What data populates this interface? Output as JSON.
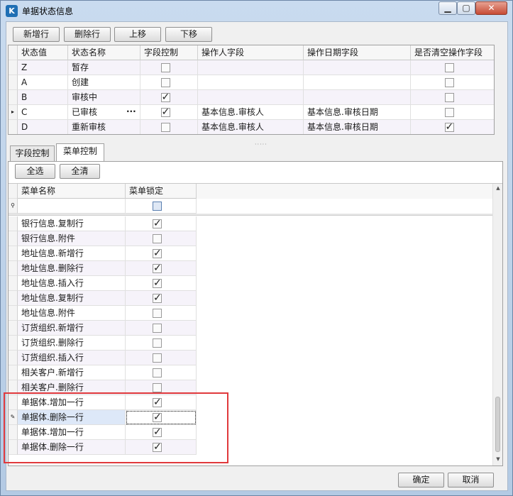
{
  "window": {
    "title": "单据状态信息",
    "app_icon": "K",
    "minimize": "▁",
    "maximize": "▢",
    "close": "✕"
  },
  "toolbar": {
    "add_row": "新增行",
    "delete_row": "删除行",
    "move_up": "上移",
    "move_down": "下移"
  },
  "status_grid": {
    "columns": [
      "状态值",
      "状态名称",
      "字段控制",
      "操作人字段",
      "操作日期字段",
      "是否清空操作字段"
    ],
    "rows": [
      {
        "value": "Z",
        "name": "暂存",
        "field_control": false,
        "operator_field": "",
        "date_field": "",
        "clear_fields": false,
        "current": false
      },
      {
        "value": "A",
        "name": "创建",
        "field_control": false,
        "operator_field": "",
        "date_field": "",
        "clear_fields": false,
        "current": false
      },
      {
        "value": "B",
        "name": "审核中",
        "field_control": true,
        "operator_field": "",
        "date_field": "",
        "clear_fields": false,
        "current": false
      },
      {
        "value": "C",
        "name": "已审核",
        "field_control": true,
        "operator_field": "基本信息.审核人",
        "date_field": "基本信息.审核日期",
        "clear_fields": false,
        "current": true,
        "ellipsis": "···"
      },
      {
        "value": "D",
        "name": "重新审核",
        "field_control": false,
        "operator_field": "基本信息.审核人",
        "date_field": "基本信息.审核日期",
        "clear_fields": true,
        "current": false
      }
    ],
    "current_row_marker": "▸"
  },
  "splitter": {
    "grip": "·····"
  },
  "tabs": [
    {
      "label": "字段控制",
      "active": false
    },
    {
      "label": "菜单控制",
      "active": true
    }
  ],
  "menu_panel": {
    "select_all": "全选",
    "clear_all": "全清",
    "columns": [
      "菜单名称",
      "菜单锁定"
    ],
    "filter_icon": "⚲",
    "rows": [
      {
        "name": "银行信息.复制行",
        "locked": true
      },
      {
        "name": "银行信息.附件",
        "locked": false
      },
      {
        "name": "地址信息.新增行",
        "locked": true
      },
      {
        "name": "地址信息.删除行",
        "locked": true
      },
      {
        "name": "地址信息.插入行",
        "locked": true
      },
      {
        "name": "地址信息.复制行",
        "locked": true
      },
      {
        "name": "地址信息.附件",
        "locked": false
      },
      {
        "name": "订货组织.新增行",
        "locked": false
      },
      {
        "name": "订货组织.删除行",
        "locked": false
      },
      {
        "name": "订货组织.插入行",
        "locked": false
      },
      {
        "name": "相关客户.新增行",
        "locked": false
      },
      {
        "name": "相关客户.删除行",
        "locked": false
      },
      {
        "name": "单据体.增加一行",
        "locked": true
      },
      {
        "name": "单据体.删除一行",
        "locked": true,
        "editing": true,
        "marker": "✎"
      },
      {
        "name": "单据体.增加一行",
        "locked": true
      },
      {
        "name": "单据体.删除一行",
        "locked": true
      }
    ],
    "scroll_up": "▲",
    "scroll_down": "▼"
  },
  "footer": {
    "ok": "确定",
    "cancel": "取消"
  },
  "colors": {
    "highlight_box": "#e0393c",
    "selected_cell": "#dde8f8"
  }
}
